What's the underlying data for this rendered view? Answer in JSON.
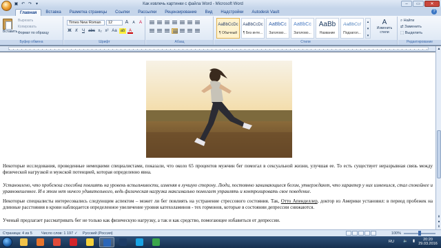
{
  "window": {
    "title": "Как извлечь картинки с файла Word - Microsoft Word",
    "controls": [
      "–",
      "▭",
      "✕"
    ]
  },
  "ribbon_tabs": [
    "Главная",
    "Вставка",
    "Разметка страницы",
    "Ссылки",
    "Рассылки",
    "Рецензирование",
    "Вид",
    "Надстройки",
    "Autodesk Vault"
  ],
  "active_tab": "Главная",
  "clipboard": {
    "paste_label": "Вставить",
    "cut": "Вырезать",
    "copy": "Копировать",
    "format_painter": "Формат по образцу",
    "group_label": "Буфер обмена"
  },
  "font": {
    "name": "Times New Roman",
    "size": "12",
    "group_label": "Шрифт",
    "bold": "Ж",
    "italic": "К",
    "underline": "Ч",
    "strike": "abc",
    "sub": "x₂",
    "sup": "x²",
    "case": "Аа",
    "grow": "A",
    "shrink": "A",
    "clear": "A",
    "highlight": "ab",
    "color": "A"
  },
  "paragraph": {
    "group_label": "Абзац"
  },
  "styles": {
    "group_label": "Стили",
    "items": [
      {
        "sample": "AaBbCcDc",
        "name": "¶ Обычный"
      },
      {
        "sample": "AaBbCcDc",
        "name": "¶ Без инте..."
      },
      {
        "sample": "AaBbCc",
        "name": "Заголово..."
      },
      {
        "sample": "AaBbCc",
        "name": "Заголово..."
      },
      {
        "sample": "AaBb",
        "name": "Название"
      },
      {
        "sample": "AaBbCcI",
        "name": "Подзагол..."
      }
    ],
    "change_styles": "Изменить стили"
  },
  "editing": {
    "group_label": "Редактирование",
    "find": "Найти",
    "replace": "Заменить",
    "select": "Выделить"
  },
  "document": {
    "p1": "Некоторые исследования, проведенные немецкими специалистами, показали, что около 65 процентов мужчин бег помогал в сексуальной жизни, улучшая ее. То есть существует неразрывная связь между физической нагрузкой и мужской потенцией, которая определенно явна.",
    "p2": "Установлено, что пробежка способна повлиять на уровень вспыльчивости, изменяя в лучшую сторону. Люди, постоянно занимающиеся бегом, утверждают, что характер у них изменился, стал спокойнее и уравновешеннее. И в этом нет ничего удивительного, ведь физическая нагрузка максимально помогает управлять и контролировать свое поведение.",
    "p3_a": "Некоторые специалисты интересовались следующим аспектом – может ли бег повлиять на устранение стрессового состояния. Так, ",
    "p3_link": "Отто Апенделлер",
    "p3_b": ", доктор из Америки установил: в период пробежек на длинные расстояния в крови наблюдается определенное увеличение уровня катехоламинов - тех гормонов, которые в состоянии депрессии снижаются.",
    "p4": "Ученый предлагает рассматривать бег не только как физическую нагрузку, а так и как средство, помогающее избавиться от депрессии."
  },
  "statusbar": {
    "page": "Страница: 4 из 5",
    "words": "Число слов: 1 197",
    "language": "Русский (Россия)",
    "zoom": "100%",
    "zoom_fraction": 0.5
  },
  "taskbar": {
    "language": "RU",
    "time": "20:20",
    "date": "29.03.2016",
    "apps": [
      {
        "name": "explorer",
        "color": "#f0c24a"
      },
      {
        "name": "media-player",
        "color": "#e8742c"
      },
      {
        "name": "chrome",
        "color": "#e04b3b"
      },
      {
        "name": "opera",
        "color": "#d2232a"
      },
      {
        "name": "yandex",
        "color": "#f5d13a"
      },
      {
        "name": "word",
        "color": "#2b66b8",
        "active": true
      },
      {
        "name": "photoshop",
        "color": "#1d3c66"
      },
      {
        "name": "skype",
        "color": "#19a3e3"
      },
      {
        "name": "camtasia",
        "color": "#3aa64b"
      }
    ]
  }
}
